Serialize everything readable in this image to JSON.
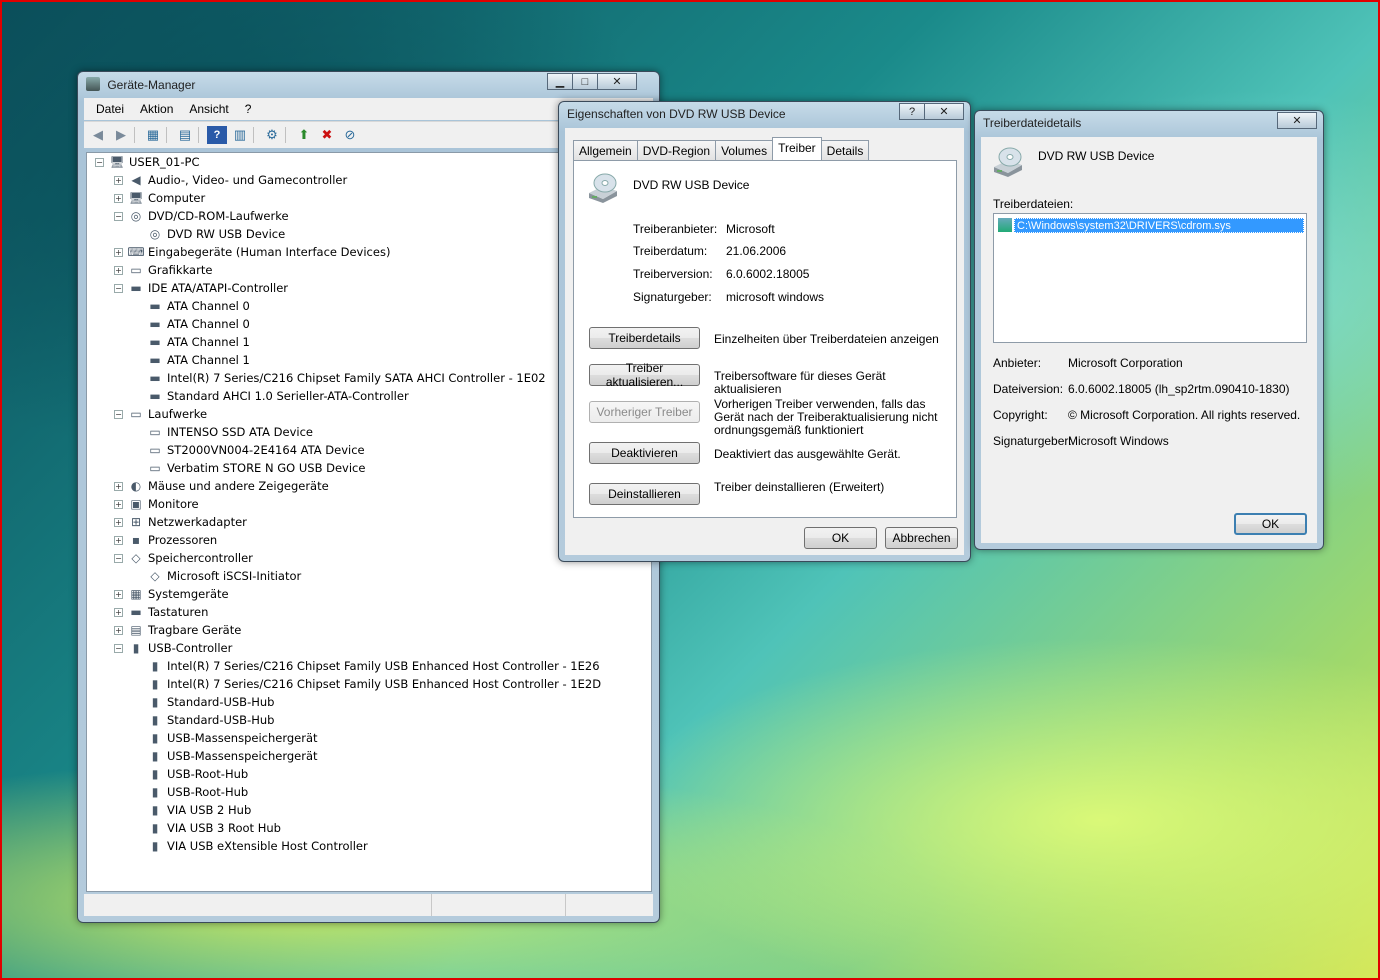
{
  "device_manager": {
    "title": "Geräte-Manager",
    "menu": [
      "Datei",
      "Aktion",
      "Ansicht",
      "?"
    ],
    "tree": [
      {
        "label": "USER_01-PC",
        "level": 0,
        "expander": "-",
        "icon": "computer-icon"
      },
      {
        "label": "Audio-, Video- und Gamecontroller",
        "level": 1,
        "expander": "+",
        "icon": "speaker-icon"
      },
      {
        "label": "Computer",
        "level": 1,
        "expander": "+",
        "icon": "computer-icon"
      },
      {
        "label": "DVD/CD-ROM-Laufwerke",
        "level": 1,
        "expander": "-",
        "icon": "cd-drive-icon"
      },
      {
        "label": "DVD RW USB Device",
        "level": 2,
        "expander": "",
        "icon": "cd-drive-icon"
      },
      {
        "label": "Eingabegeräte (Human Interface Devices)",
        "level": 1,
        "expander": "+",
        "icon": "input-device-icon"
      },
      {
        "label": "Grafikkarte",
        "level": 1,
        "expander": "+",
        "icon": "display-adapter-icon"
      },
      {
        "label": "IDE ATA/ATAPI-Controller",
        "level": 1,
        "expander": "-",
        "icon": "ide-controller-icon"
      },
      {
        "label": "ATA Channel 0",
        "level": 2,
        "expander": "",
        "icon": "ide-controller-icon"
      },
      {
        "label": "ATA Channel 0",
        "level": 2,
        "expander": "",
        "icon": "ide-controller-icon"
      },
      {
        "label": "ATA Channel 1",
        "level": 2,
        "expander": "",
        "icon": "ide-controller-icon"
      },
      {
        "label": "ATA Channel 1",
        "level": 2,
        "expander": "",
        "icon": "ide-controller-icon"
      },
      {
        "label": "Intel(R) 7 Series/C216 Chipset Family SATA AHCI Controller - 1E02",
        "level": 2,
        "expander": "",
        "icon": "ide-controller-icon"
      },
      {
        "label": "Standard AHCI 1.0 Serieller-ATA-Controller",
        "level": 2,
        "expander": "",
        "icon": "ide-controller-icon"
      },
      {
        "label": "Laufwerke",
        "level": 1,
        "expander": "-",
        "icon": "disk-drive-icon"
      },
      {
        "label": "INTENSO SSD ATA Device",
        "level": 2,
        "expander": "",
        "icon": "disk-drive-icon"
      },
      {
        "label": "ST2000VN004-2E4164 ATA Device",
        "level": 2,
        "expander": "",
        "icon": "disk-drive-icon"
      },
      {
        "label": "Verbatim STORE N GO USB Device",
        "level": 2,
        "expander": "",
        "icon": "disk-drive-icon"
      },
      {
        "label": "Mäuse und andere Zeigegeräte",
        "level": 1,
        "expander": "+",
        "icon": "mouse-icon"
      },
      {
        "label": "Monitore",
        "level": 1,
        "expander": "+",
        "icon": "monitor-icon"
      },
      {
        "label": "Netzwerkadapter",
        "level": 1,
        "expander": "+",
        "icon": "network-adapter-icon"
      },
      {
        "label": "Prozessoren",
        "level": 1,
        "expander": "+",
        "icon": "processor-icon"
      },
      {
        "label": "Speichercontroller",
        "level": 1,
        "expander": "-",
        "icon": "storage-controller-icon"
      },
      {
        "label": "Microsoft iSCSI-Initiator",
        "level": 2,
        "expander": "",
        "icon": "storage-controller-icon"
      },
      {
        "label": "Systemgeräte",
        "level": 1,
        "expander": "+",
        "icon": "system-device-icon"
      },
      {
        "label": "Tastaturen",
        "level": 1,
        "expander": "+",
        "icon": "keyboard-icon"
      },
      {
        "label": "Tragbare Geräte",
        "level": 1,
        "expander": "+",
        "icon": "portable-device-icon"
      },
      {
        "label": "USB-Controller",
        "level": 1,
        "expander": "-",
        "icon": "usb-icon"
      },
      {
        "label": "Intel(R) 7 Series/C216 Chipset Family USB Enhanced Host Controller - 1E26",
        "level": 2,
        "expander": "",
        "icon": "usb-icon"
      },
      {
        "label": "Intel(R) 7 Series/C216 Chipset Family USB Enhanced Host Controller - 1E2D",
        "level": 2,
        "expander": "",
        "icon": "usb-icon"
      },
      {
        "label": "Standard-USB-Hub",
        "level": 2,
        "expander": "",
        "icon": "usb-icon"
      },
      {
        "label": "Standard-USB-Hub",
        "level": 2,
        "expander": "",
        "icon": "usb-icon"
      },
      {
        "label": "USB-Massenspeichergerät",
        "level": 2,
        "expander": "",
        "icon": "usb-icon"
      },
      {
        "label": "USB-Massenspeichergerät",
        "level": 2,
        "expander": "",
        "icon": "usb-icon"
      },
      {
        "label": "USB-Root-Hub",
        "level": 2,
        "expander": "",
        "icon": "usb-icon"
      },
      {
        "label": "USB-Root-Hub",
        "level": 2,
        "expander": "",
        "icon": "usb-icon"
      },
      {
        "label": "VIA USB 2 Hub",
        "level": 2,
        "expander": "",
        "icon": "usb-icon"
      },
      {
        "label": "VIA USB 3 Root Hub",
        "level": 2,
        "expander": "",
        "icon": "usb-icon"
      },
      {
        "label": "VIA USB eXtensible Host Controller",
        "level": 2,
        "expander": "",
        "icon": "usb-icon"
      }
    ]
  },
  "properties": {
    "title": "Eigenschaften von DVD RW USB Device",
    "help": "?",
    "tabs": [
      "Allgemein",
      "DVD-Region",
      "Volumes",
      "Treiber",
      "Details"
    ],
    "active_tab": "Treiber",
    "device_name": "DVD RW USB Device",
    "fields": [
      {
        "label": "Treiberanbieter:",
        "value": "Microsoft"
      },
      {
        "label": "Treiberdatum:",
        "value": "21.06.2006"
      },
      {
        "label": "Treiberversion:",
        "value": "6.0.6002.18005"
      },
      {
        "label": "Signaturgeber:",
        "value": "microsoft windows"
      }
    ],
    "actions": [
      {
        "button": "Treiberdetails",
        "desc": "Einzelheiten über Treiberdateien anzeigen",
        "enabled": true
      },
      {
        "button": "Treiber aktualisieren...",
        "desc": "Treibersoftware für dieses Gerät aktualisieren",
        "enabled": true
      },
      {
        "button": "Vorheriger Treiber",
        "desc": "Vorherigen Treiber verwenden, falls das Gerät nach der Treiberaktualisierung nicht ordnungsgemäß funktioniert",
        "enabled": false
      },
      {
        "button": "Deaktivieren",
        "desc": "Deaktiviert das ausgewählte Gerät.",
        "enabled": true
      },
      {
        "button": "Deinstallieren",
        "desc": "Treiber deinstallieren (Erweitert)",
        "enabled": true
      }
    ],
    "ok": "OK",
    "cancel": "Abbrechen"
  },
  "details": {
    "title": "Treiberdateidetails",
    "device_name": "DVD RW USB Device",
    "files_label": "Treiberdateien:",
    "files": [
      "C:\\Windows\\system32\\DRIVERS\\cdrom.sys"
    ],
    "info": [
      {
        "label": "Anbieter:",
        "value": "Microsoft Corporation"
      },
      {
        "label": "Dateiversion:",
        "value": "6.0.6002.18005 (lh_sp2rtm.090410-1830)"
      },
      {
        "label": "Copyright:",
        "value": "© Microsoft Corporation. All rights reserved."
      },
      {
        "label": "Signaturgeber:",
        "value": "Microsoft Windows"
      }
    ],
    "ok": "OK"
  }
}
